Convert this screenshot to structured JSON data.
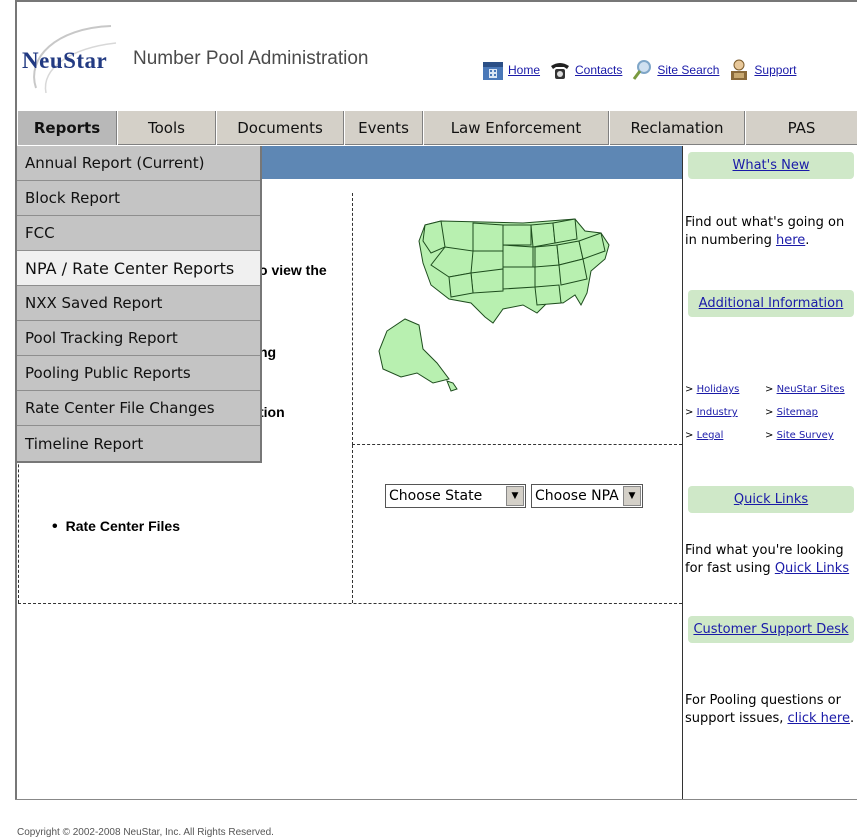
{
  "header": {
    "brand": "NeuStar",
    "tagline": "Number Pool Administration",
    "top_links": [
      {
        "label": "Home",
        "icon": "home-icon"
      },
      {
        "label": "Contacts",
        "icon": "telephone-icon"
      },
      {
        "label": "Site Search",
        "icon": "search-icon"
      },
      {
        "label": "Support",
        "icon": "support-icon"
      }
    ]
  },
  "menubar": {
    "items": [
      "Reports",
      "Tools",
      "Documents",
      "Events",
      "Law Enforcement",
      "Reclamation",
      "PAS"
    ]
  },
  "dropdown": {
    "items": [
      "Annual Report (Current)",
      "Block Report",
      "FCC",
      "NPA / Rate Center Reports",
      "NXX Saved Report",
      "Pool Tracking Report",
      "Pooling Public Reports",
      "Rate Center File Changes",
      "Timeline Report"
    ],
    "highlighted_index": 3
  },
  "main": {
    "fragments": [
      "o view the",
      "ng",
      "tion"
    ],
    "rate_center_files": "Rate Center Files",
    "state_select": "Choose State",
    "npa_select": "Choose NPA"
  },
  "sidebar": {
    "whats_new_title": "What's New",
    "whats_new_text": "Find out what's going on in numbering ",
    "whats_new_link": "here",
    "additional_title": "Additional Information",
    "links": [
      [
        "Holidays",
        "NeuStar Sites"
      ],
      [
        "Industry",
        "Sitemap"
      ],
      [
        "Legal",
        "Site Survey"
      ]
    ],
    "quick_title": "Quick Links",
    "quick_text": "Find what you're looking for fast using ",
    "quick_link": "Quick Links",
    "support_title": "Customer Support Desk",
    "support_text": "For Pooling questions or support issues, ",
    "support_link": "click here"
  },
  "footer": {
    "copyright": "Copyright © 2002-2008 NeuStar, Inc. All Rights Reserved."
  },
  "colors": {
    "menubar": "#d4d0c8",
    "blue_bar": "#5e87b4",
    "sidebar_heading": "#cfe8c8",
    "map_fill": "#b8f0b0"
  }
}
